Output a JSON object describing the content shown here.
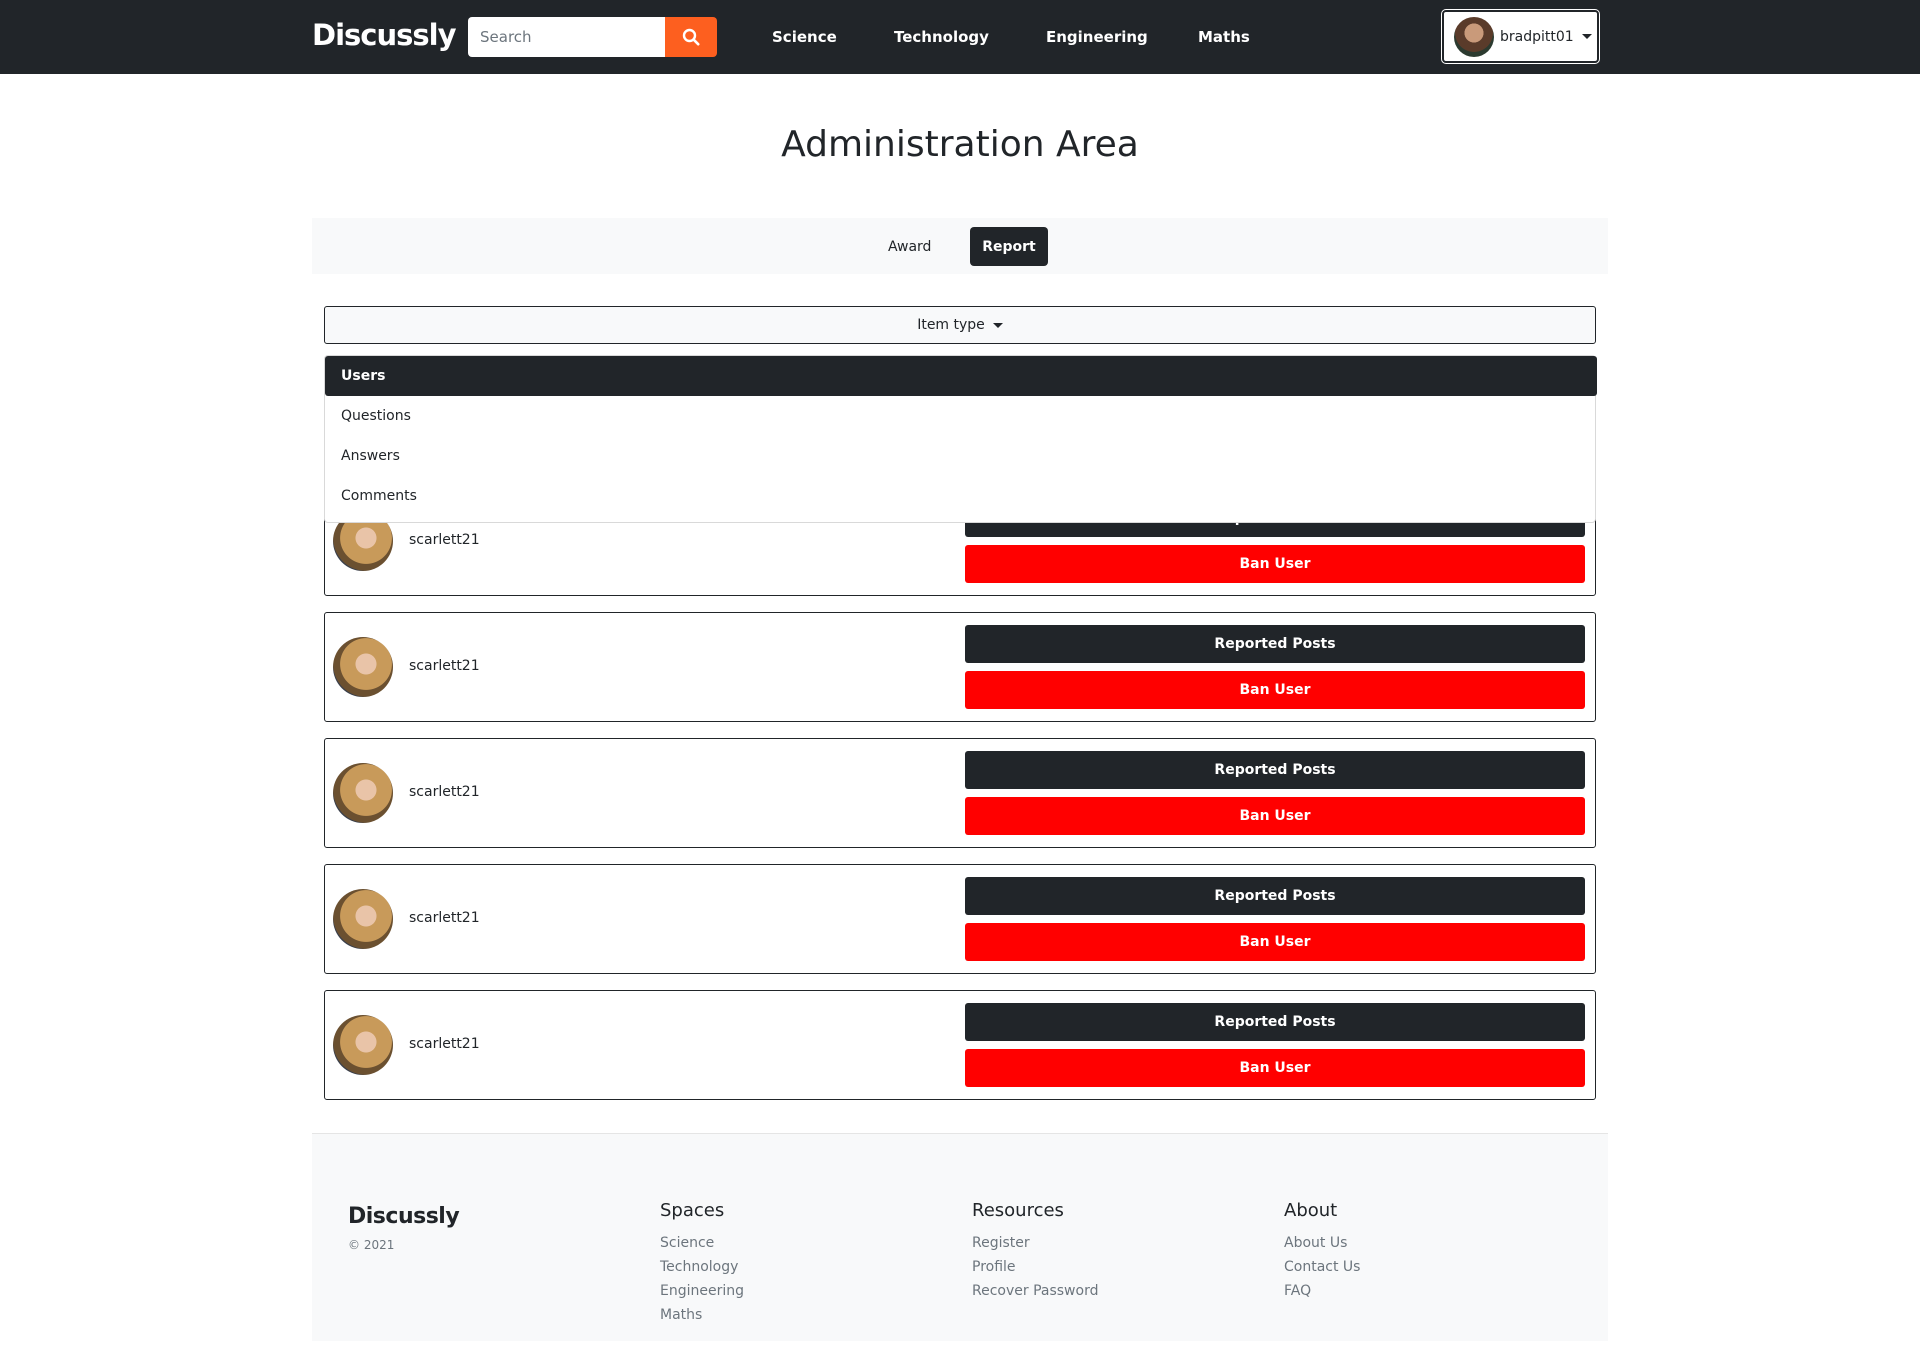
{
  "navbar": {
    "brand": "Discussly",
    "search": {
      "placeholder": "Search",
      "value": "",
      "icon": "search-icon"
    },
    "links": [
      "Science",
      "Technology",
      "Engineering",
      "Maths"
    ],
    "user": {
      "name": "bradpitt01",
      "avatar": "user-avatar"
    }
  },
  "page": {
    "title": "Administration Area"
  },
  "tabs": [
    {
      "label": "Award",
      "active": false
    },
    {
      "label": "Report",
      "active": true
    }
  ],
  "item_type": {
    "label": "Item type",
    "options": [
      "Users",
      "Questions",
      "Answers",
      "Comments"
    ],
    "selected": "Users"
  },
  "reports": [
    {
      "username": "scarlett21",
      "reported_label": "Reported Posts",
      "ban_label": "Ban User"
    },
    {
      "username": "scarlett21",
      "reported_label": "Reported Posts",
      "ban_label": "Ban User"
    },
    {
      "username": "scarlett21",
      "reported_label": "Reported Posts",
      "ban_label": "Ban User"
    },
    {
      "username": "scarlett21",
      "reported_label": "Reported Posts",
      "ban_label": "Ban User"
    },
    {
      "username": "scarlett21",
      "reported_label": "Reported Posts",
      "ban_label": "Ban User"
    }
  ],
  "footer": {
    "brand": "Discussly",
    "copyright": "© 2021",
    "columns": [
      {
        "heading": "Spaces",
        "links": [
          "Science",
          "Technology",
          "Engineering",
          "Maths"
        ]
      },
      {
        "heading": "Resources",
        "links": [
          "Register",
          "Profile",
          "Recover Password"
        ]
      },
      {
        "heading": "About",
        "links": [
          "About Us",
          "Contact Us",
          "FAQ"
        ]
      }
    ]
  },
  "colors": {
    "navbar": "#212529",
    "search_button": "#fd5f1f",
    "ban_button": "#ff0000",
    "footer_bg": "#f8f9fa"
  }
}
